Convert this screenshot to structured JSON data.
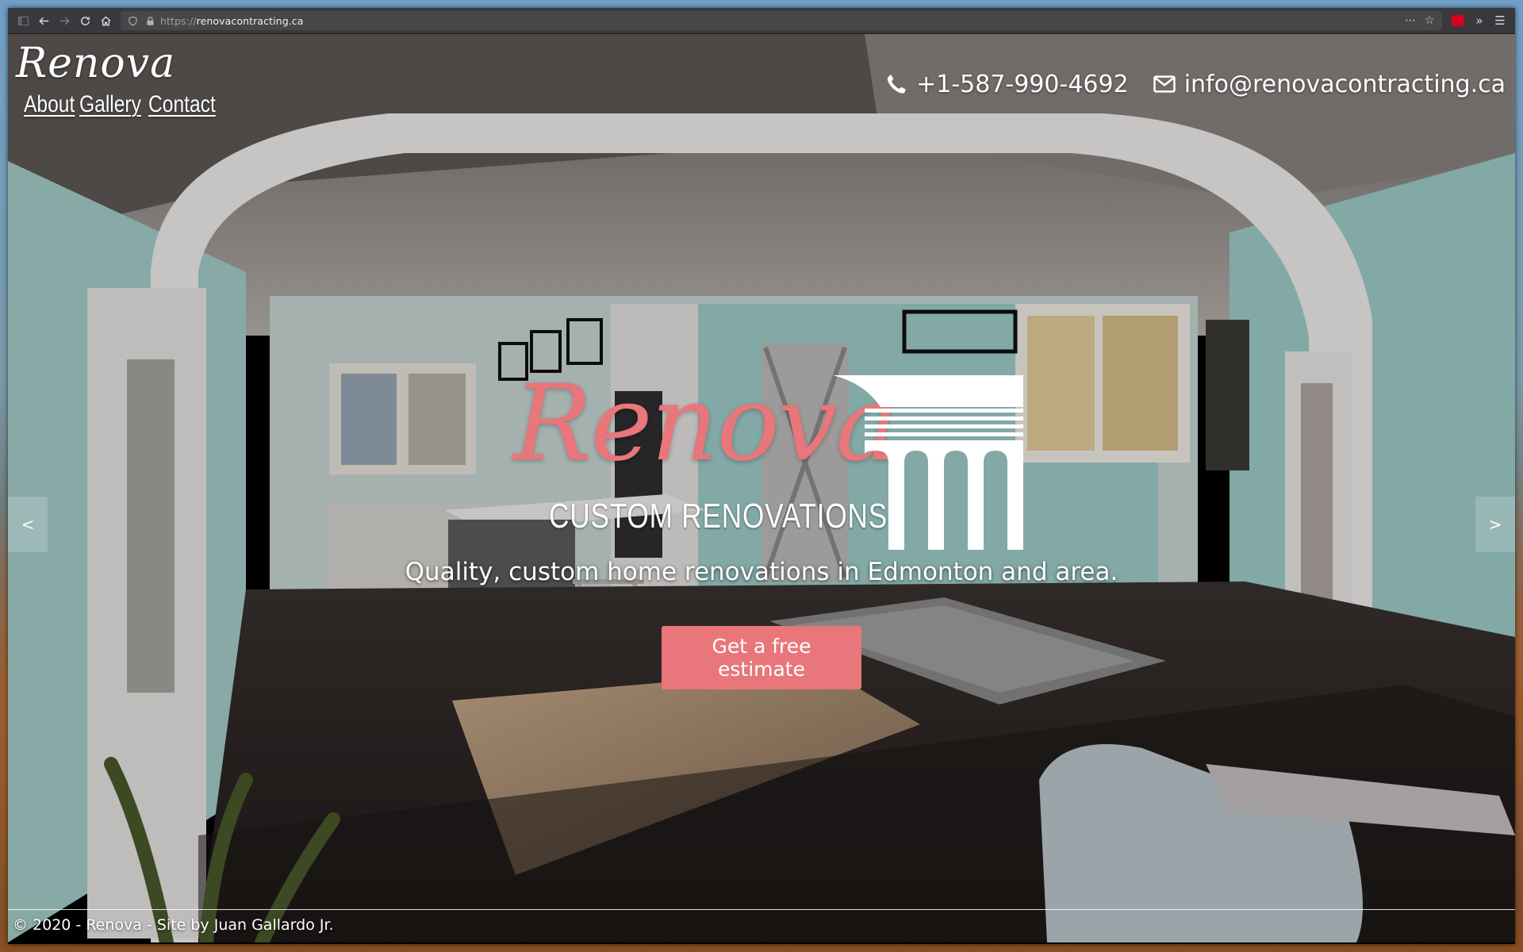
{
  "browser": {
    "url_scheme": "https://",
    "url_host": "renovacontracting.ca",
    "icons": [
      "sidebar-icon",
      "back-icon",
      "forward-icon",
      "reload-icon",
      "home-icon",
      "shield-icon",
      "lock-icon",
      "page-actions-icon",
      "bookmark-star-icon",
      "extension-icon",
      "overflow-icon",
      "menu-icon"
    ]
  },
  "header": {
    "logo": "Renova",
    "nav": [
      "About",
      "Gallery",
      "Contact"
    ],
    "phone": "+1-587-990-4692",
    "email": "info@renovacontracting.ca"
  },
  "hero": {
    "logo_script": "Renova",
    "logo_subtitle": "CUSTOM RENOVATIONS",
    "tagline": "Quality, custom home renovations in Edmonton and area.",
    "cta_label": "Get a free estimate",
    "prev_label": "<",
    "next_label": ">"
  },
  "footer": {
    "text": "© 2020 - Renova - Site by Juan Gallardo Jr."
  },
  "colors": {
    "accent": "#e8767a",
    "toolbar": "#38383d",
    "wall": "#9fcfcb",
    "floor": "#2c2624"
  }
}
